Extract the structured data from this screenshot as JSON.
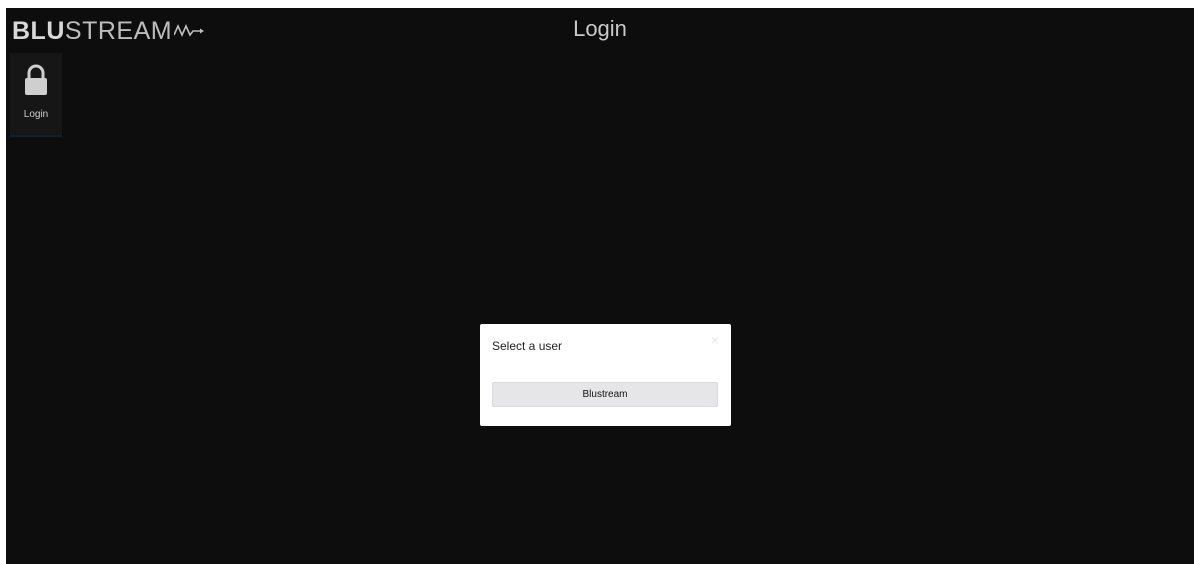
{
  "header": {
    "logo_bold": "BLU",
    "logo_light": "STREAM",
    "title": "Login"
  },
  "sidebar": {
    "items": [
      {
        "label": "Login",
        "icon": "lock-icon"
      }
    ]
  },
  "modal": {
    "title": "Select a user",
    "close_symbol": "×",
    "users": [
      {
        "label": "Blustream"
      }
    ]
  },
  "colors": {
    "background": "#0d0d0d",
    "sidebar_item": "#161616",
    "modal_bg": "#ffffff",
    "user_button_bg": "#e6e6e8"
  }
}
